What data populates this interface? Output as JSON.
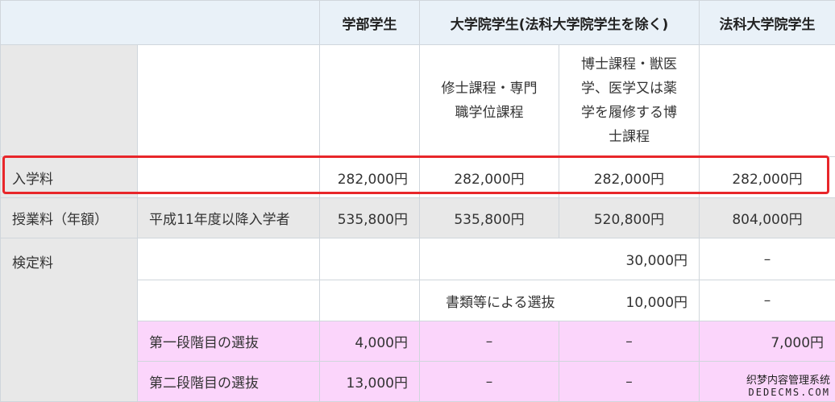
{
  "headers": {
    "undergrad": "学部学生",
    "grad": "大学院学生(法科大学院学生を除く)",
    "law": "法科大学院学生"
  },
  "subheaders": {
    "master_line1": "修士課程・専門",
    "master_line2": "職学位課程",
    "doctor_line1": "博士課程・獣医",
    "doctor_line2": "学、医学又は薬",
    "doctor_line3": "学を履修する博",
    "doctor_line4": "士課程"
  },
  "rows": {
    "admission": {
      "label": "入学料",
      "undergrad": "282,000円",
      "master": "282,000円",
      "doctor": "282,000円",
      "law": "282,000円"
    },
    "tuition": {
      "label": "授業料（年額）",
      "sublabel": "平成11年度以降入学者",
      "undergrad": "535,800円",
      "master": "535,800円",
      "doctor": "520,800円",
      "law": "804,000円"
    },
    "exam": {
      "label": "検定料",
      "grad_fee": "30,000円",
      "law_fee": "–",
      "doc_selection_label": "書類等による選抜",
      "doc_selection_fee": "10,000円",
      "doc_selection_law": "–",
      "stage1_label": "第一段階目の選抜",
      "stage1_undergrad": "4,000円",
      "stage1_master": "–",
      "stage1_doctor": "–",
      "stage1_law": "7,000円",
      "stage2_label": "第二段階目の選抜",
      "stage2_undergrad": "13,000円",
      "stage2_master": "–",
      "stage2_doctor": "–",
      "stage2_law": ""
    }
  },
  "watermark": {
    "line1": "织梦内容管理系统",
    "line2": "DEDECMS.COM"
  },
  "colors": {
    "header_bg": "#e9f1f8",
    "label_bg": "#e8e8e8",
    "pink_bg": "#fbd5fb",
    "highlight": "#e8262a",
    "border": "#d0d6dc"
  }
}
